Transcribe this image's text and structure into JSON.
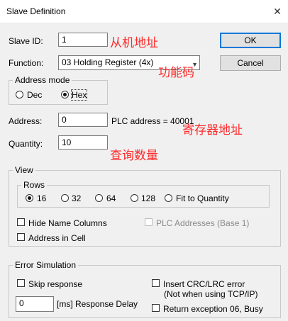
{
  "window": {
    "title": "Slave Definition",
    "close_glyph": "✕"
  },
  "fields": {
    "slave_id_label": "Slave ID:",
    "slave_id_value": "1",
    "function_label": "Function:",
    "function_value": "03 Holding Register (4x)",
    "address_label": "Address:",
    "address_value": "0",
    "plc_address_text": "PLC address = 40001",
    "quantity_label": "Quantity:",
    "quantity_value": "10"
  },
  "address_mode": {
    "title": "Address mode",
    "dec_label": "Dec",
    "hex_label": "Hex",
    "selected": "Hex"
  },
  "buttons": {
    "ok": "OK",
    "cancel": "Cancel"
  },
  "view": {
    "title": "View",
    "rows_title": "Rows",
    "rows_options": [
      "16",
      "32",
      "64",
      "128",
      "Fit to Quantity"
    ],
    "rows_selected": "16",
    "hide_name_columns": "Hide Name Columns",
    "address_in_cell": "Address in Cell",
    "plc_addresses": "PLC Addresses (Base 1)"
  },
  "error_simulation": {
    "title": "Error Simulation",
    "skip_response": "Skip response",
    "response_delay_value": "0",
    "response_delay_label": "[ms] Response Delay",
    "insert_crc_line1": "Insert CRC/LRC error",
    "insert_crc_line2": "(Not when using TCP/IP)",
    "return_exception": "Return exception 06, Busy"
  },
  "annotations": {
    "slave_address": "从机地址",
    "function_code": "功能码",
    "register_address": "寄存器地址",
    "query_quantity": "查询数量"
  },
  "colors": {
    "annotation": "#ff2a2a",
    "accent": "#0078d7"
  }
}
